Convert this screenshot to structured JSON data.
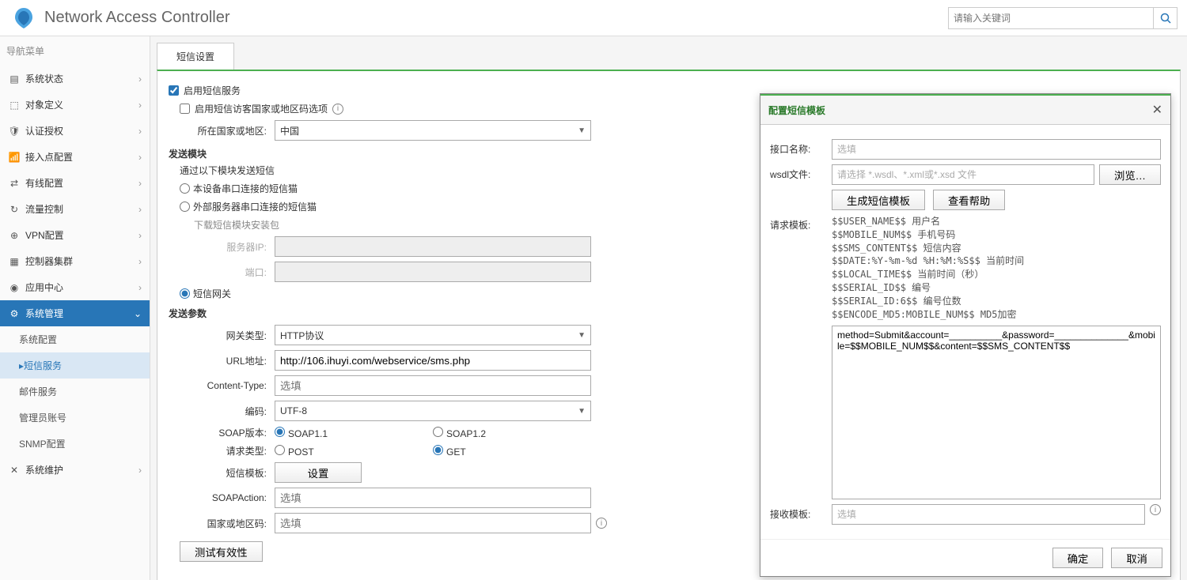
{
  "header": {
    "app_title": "Network Access Controller",
    "search_placeholder": "请输入关键词"
  },
  "sidebar": {
    "title": "导航菜单",
    "items": [
      {
        "icon": "▤",
        "label": "系统状态"
      },
      {
        "icon": "⬚",
        "label": "对象定义"
      },
      {
        "icon": "🛡",
        "label": "认证授权"
      },
      {
        "icon": "📶",
        "label": "接入点配置"
      },
      {
        "icon": "⇄",
        "label": "有线配置"
      },
      {
        "icon": "↻",
        "label": "流量控制"
      },
      {
        "icon": "⊕",
        "label": "VPN配置"
      },
      {
        "icon": "▦",
        "label": "控制器集群"
      },
      {
        "icon": "◉",
        "label": "应用中心"
      },
      {
        "icon": "⚙",
        "label": "系统管理"
      },
      {
        "icon": "✕",
        "label": "系统维护"
      }
    ],
    "subitems": [
      {
        "label": "系统配置"
      },
      {
        "label": "▸短信服务"
      },
      {
        "label": "邮件服务"
      },
      {
        "label": "管理员账号"
      },
      {
        "label": "SNMP配置"
      }
    ]
  },
  "tab": {
    "label": "短信设置"
  },
  "form": {
    "enable_sms": "启用短信服务",
    "enable_region": "启用短信访客国家或地区码选项",
    "country_label": "所在国家或地区:",
    "country_value": "中国",
    "send_module": "发送模块",
    "send_desc": "通过以下模块发送短信",
    "r_local": "本设备串口连接的短信猫",
    "r_ext": "外部服务器串口连接的短信猫",
    "dl_link": "下载短信模块安装包",
    "server_ip": "服务器IP:",
    "port": "端口:",
    "r_gw": "短信网关",
    "send_params": "发送参数",
    "gw_type_label": "网关类型:",
    "gw_type_value": "HTTP协议",
    "url_label": "URL地址:",
    "url_value": "http://106.ihuyi.com/webservice/sms.php",
    "ct_label": "Content-Type:",
    "ct_ph": "选填",
    "enc_label": "编码:",
    "enc_value": "UTF-8",
    "soap_label": "SOAP版本:",
    "soap11": "SOAP1.1",
    "soap12": "SOAP1.2",
    "req_label": "请求类型:",
    "req_post": "POST",
    "req_get": "GET",
    "tpl_label": "短信模板:",
    "tpl_btn": "设置",
    "sa_label": "SOAPAction:",
    "sa_ph": "选填",
    "cc_label": "国家或地区码:",
    "cc_ph": "选填",
    "test_btn": "测试有效性"
  },
  "modal": {
    "title": "配置短信模板",
    "if_label": "接口名称:",
    "if_ph": "选填",
    "wsdl_label": "wsdl文件:",
    "wsdl_ph": "请选择 *.wsdl、*.xml或*.xsd 文件",
    "browse": "浏览…",
    "gen_btn": "生成短信模板",
    "help_btn": "查看帮助",
    "req_tpl_label": "请求模板:",
    "vars": "$$USER_NAME$$ 用户名\n$$MOBILE_NUM$$ 手机号码\n$$SMS_CONTENT$$ 短信内容\n$$DATE:%Y-%m-%d %H:%M:%S$$ 当前时间\n$$LOCAL_TIME$$ 当前时间（秒）\n$$SERIAL_ID$$ 编号\n$$SERIAL_ID:6$$ 编号位数\n$$ENCODE_MD5:MOBILE_NUM$$ MD5加密",
    "textarea": "method=Submit&account=__________&password=______________&mobile=$$MOBILE_NUM$$&content=$$SMS_CONTENT$$",
    "recv_label": "接收模板:",
    "recv_ph": "选填",
    "ok": "确定",
    "cancel": "取消"
  }
}
